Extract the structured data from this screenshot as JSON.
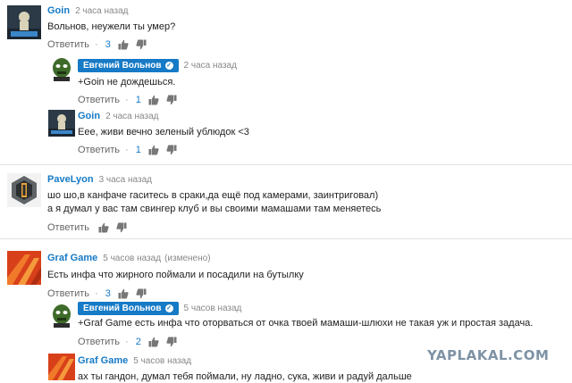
{
  "watermark": "YAPLAKAL.COM",
  "reply_label": "Ответить",
  "dot": "·",
  "comments": [
    {
      "author": "Goin",
      "time": "2 часа назад",
      "text": "Вольнов, неужели ты умер?",
      "likes": "3",
      "avatar": "goin"
    },
    {
      "author": "Евгений Вольнов",
      "verified": true,
      "time": "2 часа назад",
      "text": "+Goin не дождешься.",
      "likes": "1",
      "avatar": "volnov"
    },
    {
      "author": "Goin",
      "time": "2 часа назад",
      "text": "Еее, живи вечно зеленый ублюдок <3",
      "likes": "1",
      "avatar": "goin"
    },
    {
      "author": "PaveLyon",
      "time": "3 часа назад",
      "text_lines": [
        "шо шо,в канфаче гаситесь в сраки,да ещё под камерами, заинтриговал)",
        "а я думал у вас там свингер клуб и вы своими мамашами там меняетесь"
      ],
      "avatar": "pavelyon"
    },
    {
      "author": "Graf Game",
      "time": "5 часов назад",
      "edited": "(изменено)",
      "text": "Есть инфа что жирного поймали и посадили на бутылку",
      "likes": "3",
      "avatar": "graf"
    },
    {
      "author": "Евгений Вольнов",
      "verified": true,
      "time": "5 часов назад",
      "text": "+Graf Game есть инфа что оторваться от очка твоей мамаши-шлюхи не такая уж и простая задача.",
      "likes": "2",
      "avatar": "volnov"
    },
    {
      "author": "Graf Game",
      "time": "5 часов назад",
      "text": "ах ты гандон, думал тебя поймали, ну ладно, сука, живи и радуй дальше",
      "avatar": "graf"
    }
  ],
  "colors": {
    "link": "#167ac6",
    "meta": "#888888",
    "badge_bg": "#167ac6",
    "watermark": "#7f93a6"
  }
}
